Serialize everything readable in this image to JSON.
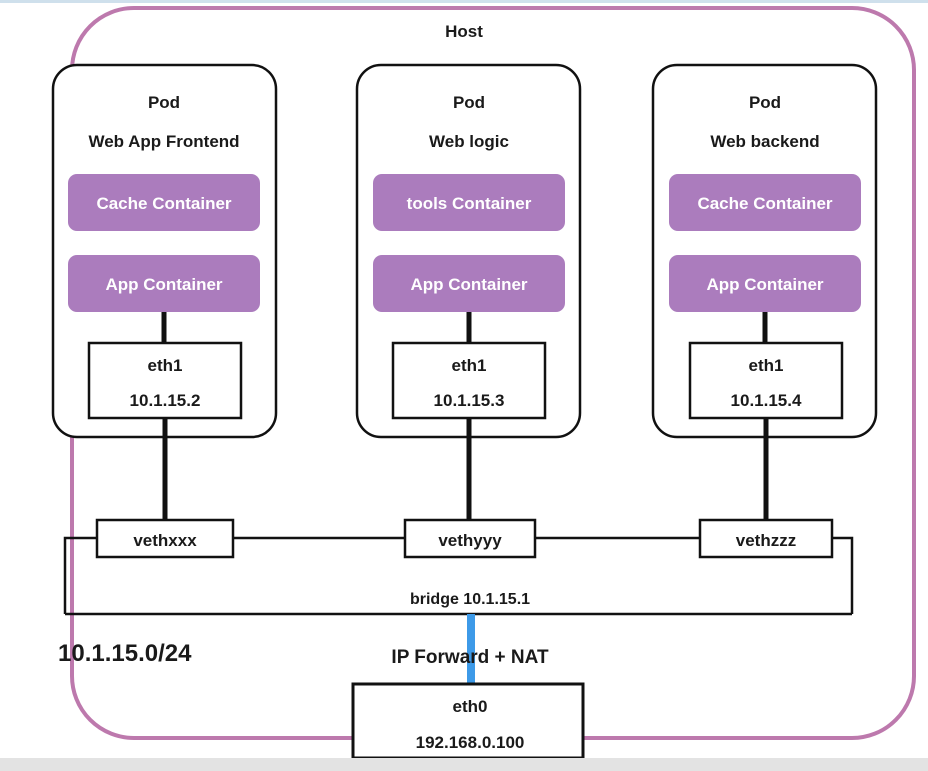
{
  "diagram": {
    "title": "Host",
    "subnet_label": "10.1.15.0/24",
    "bridge_label": "bridge  10.1.15.1",
    "nat_label": "IP Forward + NAT",
    "colors": {
      "host_border": "#bd79ad",
      "container_fill": "#ab7cbd",
      "container_text": "#ffffff",
      "box_stroke": "#111111",
      "uplink": "#3d9ae8",
      "background": "#ffffff",
      "top_strip": "#cfe0ec",
      "bottom_strip": "#e3e3e3"
    },
    "pods": [
      {
        "title": "Pod",
        "subtitle": "Web App Frontend",
        "containers": [
          "Cache Container",
          "App Container"
        ],
        "interface": {
          "name": "eth1",
          "ip": "10.1.15.2"
        },
        "veth": "vethxxx"
      },
      {
        "title": "Pod",
        "subtitle": "Web logic",
        "containers": [
          "tools Container",
          "App Container"
        ],
        "interface": {
          "name": "eth1",
          "ip": "10.1.15.3"
        },
        "veth": "vethyyy"
      },
      {
        "title": "Pod",
        "subtitle": "Web backend",
        "containers": [
          "Cache Container",
          "App Container"
        ],
        "interface": {
          "name": "eth1",
          "ip": "10.1.15.4"
        },
        "veth": "vethzzz"
      }
    ],
    "uplink": {
      "name": "eth0",
      "ip": "192.168.0.100"
    }
  }
}
